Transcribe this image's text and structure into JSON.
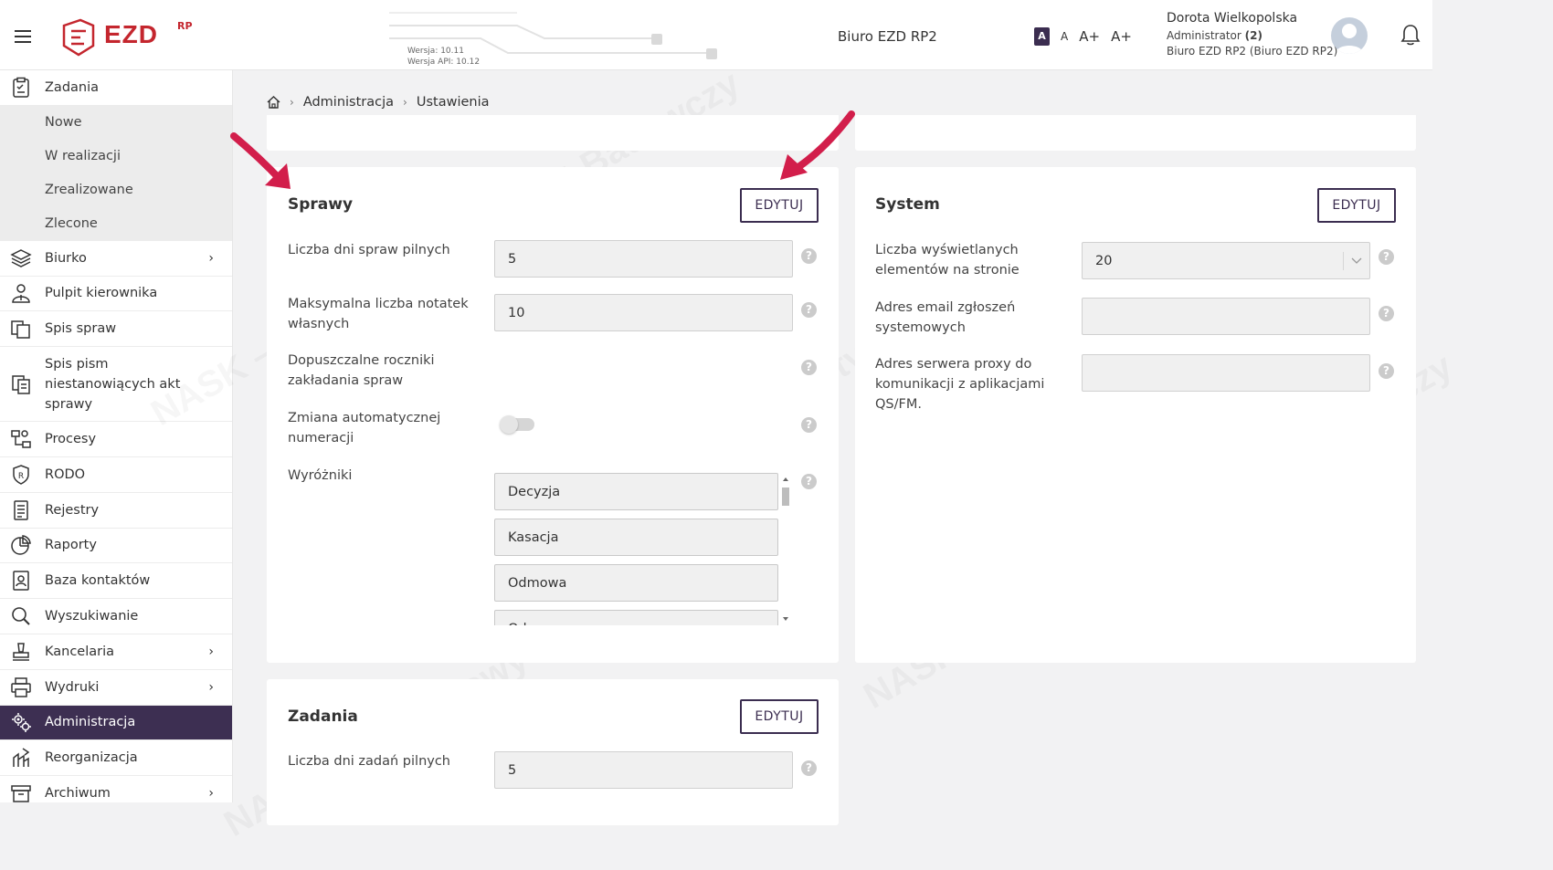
{
  "header": {
    "logo_text": "EZD",
    "logo_suffix": "RP",
    "version": "Wersja: 10.11",
    "api_version": "Wersja API: 10.12",
    "office_title": "Biuro EZD RP2",
    "font_sizes": [
      "A",
      "A",
      "A+",
      "A+"
    ],
    "user": {
      "name": "Dorota Wielkopolska",
      "role": "Administrator",
      "role_count": "(2)",
      "office": "Biuro EZD RP2 (Biuro EZD RP2)"
    }
  },
  "sidebar": {
    "items": [
      {
        "label": "Zadania",
        "icon": "clipboard-icon"
      },
      {
        "label": "Biurko",
        "icon": "layers-icon",
        "chevron": "›"
      },
      {
        "label": "Pulpit kierownika",
        "icon": "manager-icon"
      },
      {
        "label": "Spis spraw",
        "icon": "files-icon"
      },
      {
        "label": "Spis pism niestanowiących akt sprawy",
        "icon": "documents-icon"
      },
      {
        "label": "Procesy",
        "icon": "process-icon"
      },
      {
        "label": "RODO",
        "icon": "shield-icon"
      },
      {
        "label": "Rejestry",
        "icon": "register-icon"
      },
      {
        "label": "Raporty",
        "icon": "pie-chart-icon"
      },
      {
        "label": "Baza kontaktów",
        "icon": "contacts-icon"
      },
      {
        "label": "Wyszukiwanie",
        "icon": "search-icon"
      },
      {
        "label": "Kancelaria",
        "icon": "stamp-icon",
        "chevron": "›"
      },
      {
        "label": "Wydruki",
        "icon": "printer-icon",
        "chevron": "›"
      },
      {
        "label": "Administracja",
        "icon": "gears-icon"
      },
      {
        "label": "Reorganizacja",
        "icon": "reorg-icon"
      },
      {
        "label": "Archiwum",
        "icon": "archive-icon",
        "chevron": "›"
      }
    ],
    "sub_items": [
      "Nowe",
      "W realizacji",
      "Zrealizowane",
      "Zlecone"
    ]
  },
  "breadcrumb": {
    "items": [
      "Administracja",
      "Ustawienia"
    ],
    "separator": "›"
  },
  "sprawy": {
    "title": "Sprawy",
    "edit_label": "EDYTUJ",
    "fields": {
      "urgent_days": {
        "label": "Liczba dni spraw pilnych",
        "value": "5"
      },
      "max_notes": {
        "label": "Maksymalna liczba notatek własnych",
        "value": "10"
      },
      "years": {
        "label": "Dopuszczalne roczniki zakładania spraw"
      },
      "auto_numbering": {
        "label": "Zmiana automatycznej numeracji",
        "value": false
      },
      "highlights": {
        "label": "Wyróżniki",
        "values": [
          "Decyzja",
          "Kasacja",
          "Odmowa",
          "Odmowa..."
        ]
      }
    }
  },
  "system": {
    "title": "System",
    "edit_label": "EDYTUJ",
    "fields": {
      "items_per_page": {
        "label": "Liczba wyświetlanych elementów na stronie",
        "value": "20"
      },
      "report_email": {
        "label": "Adres email zgłoszeń systemowych",
        "value": ""
      },
      "proxy": {
        "label": "Adres serwera proxy do komunikacji z aplikacjami QS/FM.",
        "value": ""
      }
    }
  },
  "zadania": {
    "title": "Zadania",
    "edit_label": "EDYTUJ",
    "fields": {
      "urgent_days": {
        "label": "Liczba dni zadań pilnych",
        "value": "5"
      }
    }
  },
  "help_glyph": "?",
  "colors": {
    "brand": "#c4262e",
    "accent": "#3b2d50",
    "annotation_arrow": "#d21e4b"
  }
}
